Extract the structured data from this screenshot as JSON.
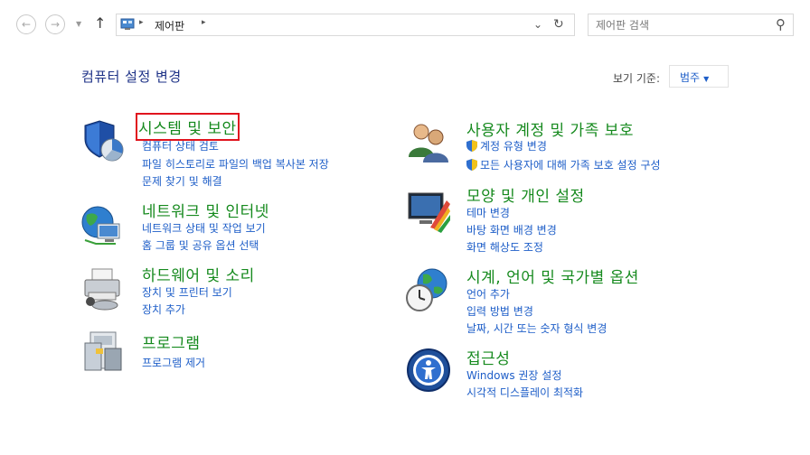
{
  "nav": {
    "back_icon": "arrow-left-icon",
    "forward_icon": "arrow-right-icon",
    "recent_icon": "chevron-down-icon",
    "up_icon": "arrow-up-icon"
  },
  "address": {
    "path": "제어판",
    "separator": "▸",
    "dropdown_icon": "chevron-down-icon",
    "refresh_icon": "refresh-icon"
  },
  "search": {
    "placeholder": "제어판 검색",
    "icon": "search-icon"
  },
  "page_title": "컴퓨터 설정 변경",
  "view_by": {
    "label": "보기 기준:",
    "value": "범주"
  },
  "categories": [
    {
      "title": "시스템 및 보안",
      "highlighted": true,
      "links": [
        "컴퓨터 상태 검토",
        "파일 히스토리로 파일의 백업 복사본 저장",
        "문제 찾기 및 해결"
      ]
    },
    {
      "title": "네트워크 및 인터넷",
      "links": [
        "네트워크 상태 및 작업 보기",
        "홈 그룹 및 공유 옵션 선택"
      ]
    },
    {
      "title": "하드웨어 및 소리",
      "links": [
        "장치 및 프린터 보기",
        "장치 추가"
      ]
    },
    {
      "title": "프로그램",
      "links": [
        "프로그램 제거"
      ]
    },
    {
      "title": "사용자 계정 및 가족 보호",
      "links": [
        "계정 유형 변경",
        "모든 사용자에 대해 가족 보호 설정 구성"
      ]
    },
    {
      "title": "모양 및 개인 설정",
      "links": [
        "테마 변경",
        "바탕 화면 배경 변경",
        "화면 해상도 조정"
      ]
    },
    {
      "title": "시계, 언어 및 국가별 옵션",
      "links": [
        "언어 추가",
        "입력 방법 변경",
        "날짜, 시간 또는 숫자 형식 변경"
      ]
    },
    {
      "title": "접근성",
      "links": [
        "Windows 권장 설정",
        "시각적 디스플레이 최적화"
      ]
    }
  ],
  "colors": {
    "title_green": "#168a1e",
    "link_blue": "#1e5ec8",
    "heading_blue": "#1e3287",
    "highlight_red": "#e0141e"
  }
}
